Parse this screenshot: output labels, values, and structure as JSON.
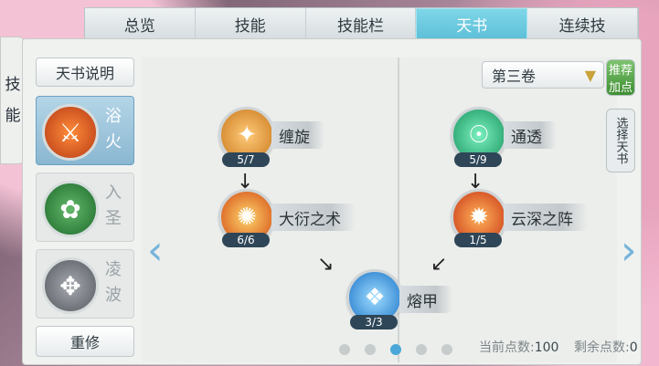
{
  "tabs": [
    "总览",
    "技能",
    "技能栏",
    "天书",
    "连续技"
  ],
  "active_tab": "天书",
  "left_strip_chars": [
    "技",
    "能"
  ],
  "explain_button": "天书说明",
  "books": [
    {
      "name": "浴火",
      "icon": "fire-bow-icon"
    },
    {
      "name": "入圣",
      "icon": "jade-bow-icon"
    },
    {
      "name": "凌波",
      "icon": "silver-bow-icon"
    }
  ],
  "reset_button": "重修",
  "volume_label": "第三卷",
  "side_buttons": {
    "recommend": "推荐加点",
    "select_book": "选择天书"
  },
  "skills": [
    {
      "name": "缠旋",
      "level": "5/7",
      "icon": "scroll-icon"
    },
    {
      "name": "大衍之术",
      "level": "6/6",
      "icon": "fire-burst-icon"
    },
    {
      "name": "熔甲",
      "level": "3/3",
      "icon": "crystal-icon"
    },
    {
      "name": "通透",
      "level": "5/9",
      "icon": "spirit-figure-icon"
    },
    {
      "name": "云深之阵",
      "level": "1/5",
      "icon": "fire-ring-icon"
    }
  ],
  "status": {
    "current_label": "当前点数:",
    "current_value": "100",
    "remain_label": "剩余点数:",
    "remain_value": "0"
  },
  "page_dots": 5,
  "active_dot_index": 2
}
